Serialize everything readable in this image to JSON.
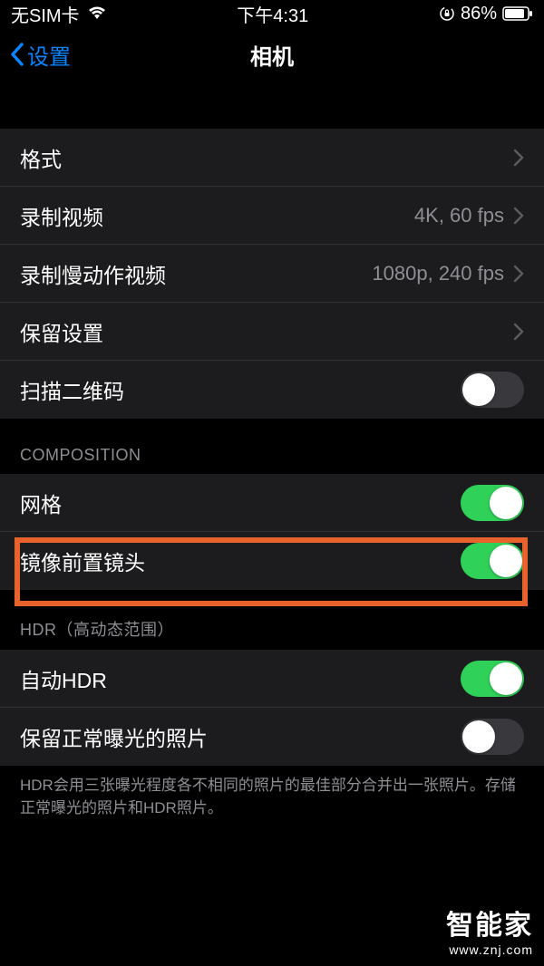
{
  "status": {
    "sim": "无SIM卡",
    "time": "下午4:31",
    "battery_pct": "86%"
  },
  "nav": {
    "back": "设置",
    "title": "相机"
  },
  "rows": {
    "format": "格式",
    "record_video": "录制视频",
    "record_video_value": "4K, 60 fps",
    "record_slowmo": "录制慢动作视频",
    "record_slowmo_value": "1080p, 240 fps",
    "preserve": "保留设置",
    "scan_qr": "扫描二维码",
    "grid": "网格",
    "mirror_front": "镜像前置镜头",
    "auto_hdr": "自动HDR",
    "keep_normal": "保留正常曝光的照片"
  },
  "sections": {
    "composition": "COMPOSITION",
    "hdr": "HDR（高动态范围）"
  },
  "footer": {
    "hdr_desc": "HDR会用三张曝光程度各不相同的照片的最佳部分合并出一张照片。存储正常曝光的照片和HDR照片。"
  },
  "toggles": {
    "scan_qr": false,
    "grid": true,
    "mirror_front": true,
    "auto_hdr": true,
    "keep_normal": false
  },
  "watermark": {
    "main": "智能家",
    "sub": "www.znj.com"
  }
}
